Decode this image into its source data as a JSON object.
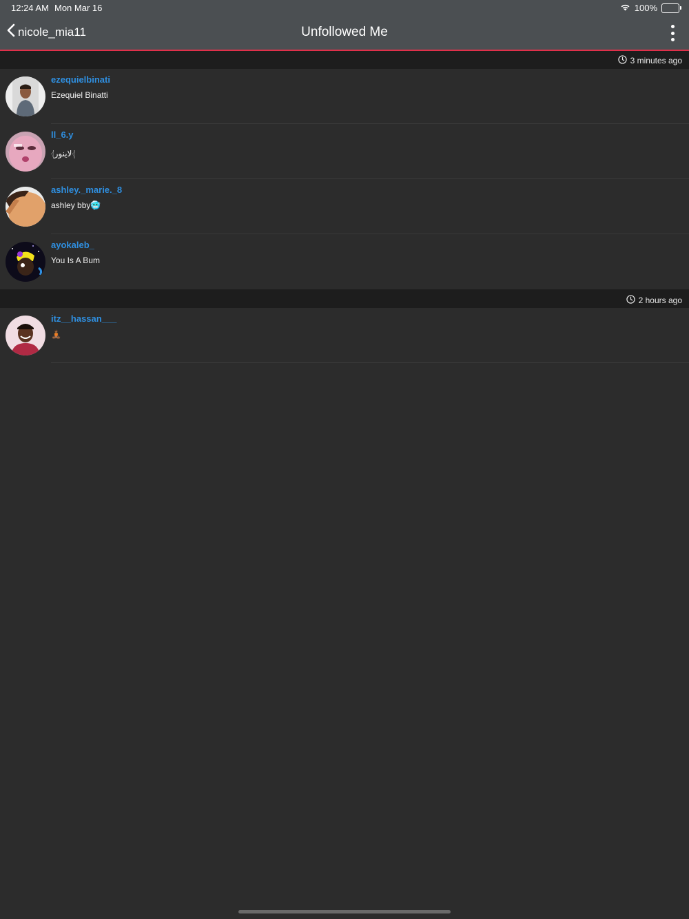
{
  "status_bar": {
    "time": "12:24 AM",
    "date": "Mon Mar 16",
    "battery": "100%",
    "battery_level": 1.0
  },
  "nav": {
    "back_label": "nicole_mia11",
    "title": "Unfollowed Me"
  },
  "sections": [
    {
      "time_label": "3 minutes ago",
      "users": [
        {
          "username": "ezequielbinati",
          "full_name": "Ezequiel Binatti"
        },
        {
          "username": "ll_6.y",
          "full_name": "𓂆لاينور𓂆"
        },
        {
          "username": "ashley._marie._8",
          "full_name": "ashley bby🥶"
        },
        {
          "username": "ayokaleb_",
          "full_name": "You Is A Bum"
        }
      ]
    },
    {
      "time_label": "2 hours ago",
      "users": [
        {
          "username": "itz__hassan___",
          "full_name": "🧘🏾"
        }
      ]
    }
  ],
  "colors": {
    "accent": "#2f8fe0",
    "header_bg": "#4b4f52",
    "header_underline": "#e0304a",
    "background": "#2c2c2c",
    "section_bg": "#1d1d1d"
  }
}
